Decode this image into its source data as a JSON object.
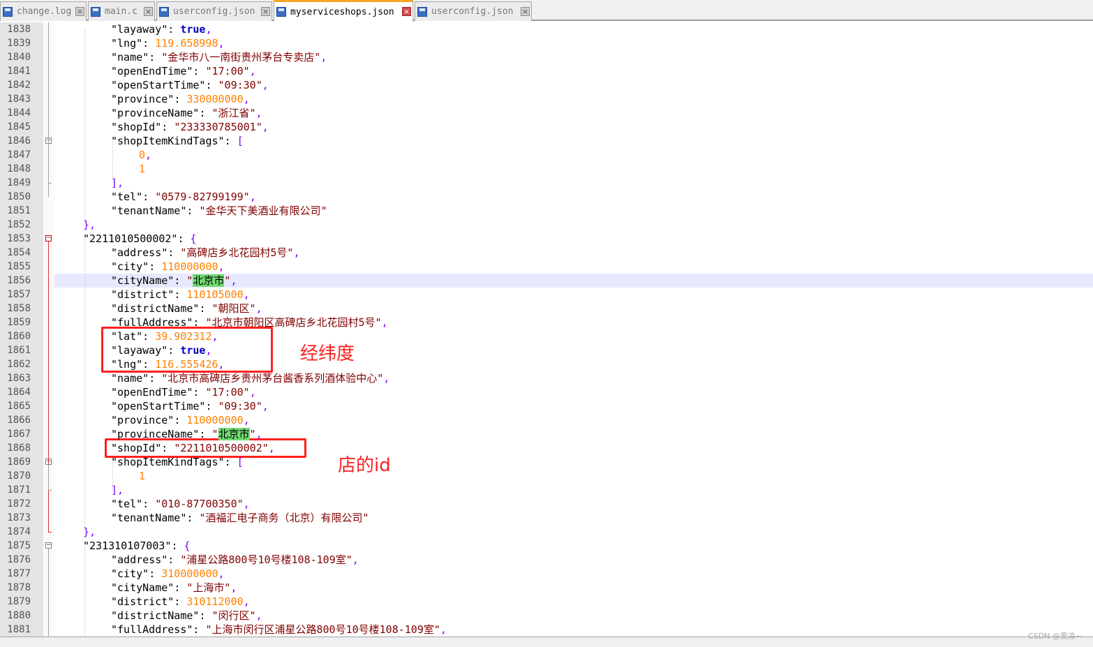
{
  "tabs": [
    {
      "label": "change.log",
      "active": false
    },
    {
      "label": "main.c",
      "active": false
    },
    {
      "label": "userconfig.json",
      "active": false
    },
    {
      "label": "myserviceshops.json",
      "active": true
    },
    {
      "label": "userconfig.json",
      "active": false
    }
  ],
  "lines": [
    {
      "num": "1838",
      "indent": 2,
      "tokens": [
        [
          "k",
          "\"layaway\""
        ],
        [
          "c",
          ": "
        ],
        [
          "b",
          "true"
        ],
        [
          "p",
          ","
        ]
      ]
    },
    {
      "num": "1839",
      "indent": 2,
      "tokens": [
        [
          "k",
          "\"lng\""
        ],
        [
          "c",
          ": "
        ],
        [
          "n",
          "119.658998"
        ],
        [
          "p",
          ","
        ]
      ]
    },
    {
      "num": "1840",
      "indent": 2,
      "tokens": [
        [
          "k",
          "\"name\""
        ],
        [
          "c",
          ": "
        ],
        [
          "s",
          "\"金华市八一南街贵州茅台专卖店\""
        ],
        [
          "p",
          ","
        ]
      ]
    },
    {
      "num": "1841",
      "indent": 2,
      "tokens": [
        [
          "k",
          "\"openEndTime\""
        ],
        [
          "c",
          ": "
        ],
        [
          "s",
          "\"17:00\""
        ],
        [
          "p",
          ","
        ]
      ]
    },
    {
      "num": "1842",
      "indent": 2,
      "tokens": [
        [
          "k",
          "\"openStartTime\""
        ],
        [
          "c",
          ": "
        ],
        [
          "s",
          "\"09:30\""
        ],
        [
          "p",
          ","
        ]
      ]
    },
    {
      "num": "1843",
      "indent": 2,
      "tokens": [
        [
          "k",
          "\"province\""
        ],
        [
          "c",
          ": "
        ],
        [
          "n",
          "330000000"
        ],
        [
          "p",
          ","
        ]
      ]
    },
    {
      "num": "1844",
      "indent": 2,
      "tokens": [
        [
          "k",
          "\"provinceName\""
        ],
        [
          "c",
          ": "
        ],
        [
          "s",
          "\"浙江省\""
        ],
        [
          "p",
          ","
        ]
      ]
    },
    {
      "num": "1845",
      "indent": 2,
      "tokens": [
        [
          "k",
          "\"shopId\""
        ],
        [
          "c",
          ": "
        ],
        [
          "s",
          "\"233330785001\""
        ],
        [
          "p",
          ","
        ]
      ]
    },
    {
      "num": "1846",
      "indent": 2,
      "tokens": [
        [
          "k",
          "\"shopItemKindTags\""
        ],
        [
          "c",
          ": "
        ],
        [
          "p",
          "["
        ]
      ]
    },
    {
      "num": "1847",
      "indent": 3,
      "tokens": [
        [
          "n",
          "0"
        ],
        [
          "p",
          ","
        ]
      ]
    },
    {
      "num": "1848",
      "indent": 3,
      "tokens": [
        [
          "n",
          "1"
        ]
      ]
    },
    {
      "num": "1849",
      "indent": 2,
      "tokens": [
        [
          "p",
          "],"
        ]
      ]
    },
    {
      "num": "1850",
      "indent": 2,
      "tokens": [
        [
          "k",
          "\"tel\""
        ],
        [
          "c",
          ": "
        ],
        [
          "s",
          "\"0579-82799199\""
        ],
        [
          "p",
          ","
        ]
      ]
    },
    {
      "num": "1851",
      "indent": 2,
      "tokens": [
        [
          "k",
          "\"tenantName\""
        ],
        [
          "c",
          ": "
        ],
        [
          "s",
          "\"金华天下美酒业有限公司\""
        ]
      ]
    },
    {
      "num": "1852",
      "indent": 1,
      "tokens": [
        [
          "p",
          "},"
        ]
      ]
    },
    {
      "num": "1853",
      "indent": 1,
      "tokens": [
        [
          "k",
          "\"2211010500002\""
        ],
        [
          "c",
          ": "
        ],
        [
          "p",
          "{"
        ]
      ]
    },
    {
      "num": "1854",
      "indent": 2,
      "tokens": [
        [
          "k",
          "\"address\""
        ],
        [
          "c",
          ": "
        ],
        [
          "s",
          "\"高碑店乡北花园村5号\""
        ],
        [
          "p",
          ","
        ]
      ]
    },
    {
      "num": "1855",
      "indent": 2,
      "tokens": [
        [
          "k",
          "\"city\""
        ],
        [
          "c",
          ": "
        ],
        [
          "n",
          "110000000"
        ],
        [
          "p",
          ","
        ]
      ]
    },
    {
      "num": "1856",
      "indent": 2,
      "tokens": [
        [
          "k",
          "\"cityName\""
        ],
        [
          "c",
          ": "
        ],
        [
          "s",
          "\""
        ],
        [
          "hl",
          "北京市"
        ],
        [
          "s",
          "\""
        ],
        [
          "p",
          ","
        ]
      ]
    },
    {
      "num": "1857",
      "indent": 2,
      "tokens": [
        [
          "k",
          "\"district\""
        ],
        [
          "c",
          ": "
        ],
        [
          "n",
          "110105000"
        ],
        [
          "p",
          ","
        ]
      ]
    },
    {
      "num": "1858",
      "indent": 2,
      "tokens": [
        [
          "k",
          "\"districtName\""
        ],
        [
          "c",
          ": "
        ],
        [
          "s",
          "\"朝阳区\""
        ],
        [
          "p",
          ","
        ]
      ]
    },
    {
      "num": "1859",
      "indent": 2,
      "tokens": [
        [
          "k",
          "\"fullAddress\""
        ],
        [
          "c",
          ": "
        ],
        [
          "s",
          "\"北京市朝阳区高碑店乡北花园村5号\""
        ],
        [
          "p",
          ","
        ]
      ]
    },
    {
      "num": "1860",
      "indent": 2,
      "tokens": [
        [
          "k",
          "\"lat\""
        ],
        [
          "c",
          ": "
        ],
        [
          "n",
          "39.902312"
        ],
        [
          "p",
          ","
        ]
      ]
    },
    {
      "num": "1861",
      "indent": 2,
      "tokens": [
        [
          "k",
          "\"layaway\""
        ],
        [
          "c",
          ": "
        ],
        [
          "b",
          "true"
        ],
        [
          "p",
          ","
        ]
      ]
    },
    {
      "num": "1862",
      "indent": 2,
      "tokens": [
        [
          "k",
          "\"lng\""
        ],
        [
          "c",
          ": "
        ],
        [
          "n",
          "116.555426"
        ],
        [
          "p",
          ","
        ]
      ]
    },
    {
      "num": "1863",
      "indent": 2,
      "tokens": [
        [
          "k",
          "\"name\""
        ],
        [
          "c",
          ": "
        ],
        [
          "s",
          "\"北京市高碑店乡贵州茅台酱香系列酒体验中心\""
        ],
        [
          "p",
          ","
        ]
      ]
    },
    {
      "num": "1864",
      "indent": 2,
      "tokens": [
        [
          "k",
          "\"openEndTime\""
        ],
        [
          "c",
          ": "
        ],
        [
          "s",
          "\"17:00\""
        ],
        [
          "p",
          ","
        ]
      ]
    },
    {
      "num": "1865",
      "indent": 2,
      "tokens": [
        [
          "k",
          "\"openStartTime\""
        ],
        [
          "c",
          ": "
        ],
        [
          "s",
          "\"09:30\""
        ],
        [
          "p",
          ","
        ]
      ]
    },
    {
      "num": "1866",
      "indent": 2,
      "tokens": [
        [
          "k",
          "\"province\""
        ],
        [
          "c",
          ": "
        ],
        [
          "n",
          "110000000"
        ],
        [
          "p",
          ","
        ]
      ]
    },
    {
      "num": "1867",
      "indent": 2,
      "tokens": [
        [
          "k",
          "\"provinceName\""
        ],
        [
          "c",
          ": "
        ],
        [
          "s",
          "\""
        ],
        [
          "hl",
          "北京市"
        ],
        [
          "s",
          "\""
        ],
        [
          "p",
          ","
        ]
      ]
    },
    {
      "num": "1868",
      "indent": 2,
      "tokens": [
        [
          "k",
          "\"shopId\""
        ],
        [
          "c",
          ": "
        ],
        [
          "s",
          "\"2211010500002\""
        ],
        [
          "p",
          ","
        ]
      ]
    },
    {
      "num": "1869",
      "indent": 2,
      "tokens": [
        [
          "k",
          "\"shopItemKindTags\""
        ],
        [
          "c",
          ": "
        ],
        [
          "p",
          "["
        ]
      ]
    },
    {
      "num": "1870",
      "indent": 3,
      "tokens": [
        [
          "n",
          "1"
        ]
      ]
    },
    {
      "num": "1871",
      "indent": 2,
      "tokens": [
        [
          "p",
          "],"
        ]
      ]
    },
    {
      "num": "1872",
      "indent": 2,
      "tokens": [
        [
          "k",
          "\"tel\""
        ],
        [
          "c",
          ": "
        ],
        [
          "s",
          "\"010-87700350\""
        ],
        [
          "p",
          ","
        ]
      ]
    },
    {
      "num": "1873",
      "indent": 2,
      "tokens": [
        [
          "k",
          "\"tenantName\""
        ],
        [
          "c",
          ": "
        ],
        [
          "s",
          "\"酒福汇电子商务（北京）有限公司\""
        ]
      ]
    },
    {
      "num": "1874",
      "indent": 1,
      "tokens": [
        [
          "p",
          "},"
        ]
      ]
    },
    {
      "num": "1875",
      "indent": 1,
      "tokens": [
        [
          "k",
          "\"231310107003\""
        ],
        [
          "c",
          ": "
        ],
        [
          "p",
          "{"
        ]
      ]
    },
    {
      "num": "1876",
      "indent": 2,
      "tokens": [
        [
          "k",
          "\"address\""
        ],
        [
          "c",
          ": "
        ],
        [
          "s",
          "\"浦星公路800号10号楼108-109室\""
        ],
        [
          "p",
          ","
        ]
      ]
    },
    {
      "num": "1877",
      "indent": 2,
      "tokens": [
        [
          "k",
          "\"city\""
        ],
        [
          "c",
          ": "
        ],
        [
          "n",
          "310000000"
        ],
        [
          "p",
          ","
        ]
      ]
    },
    {
      "num": "1878",
      "indent": 2,
      "tokens": [
        [
          "k",
          "\"cityName\""
        ],
        [
          "c",
          ": "
        ],
        [
          "s",
          "\"上海市\""
        ],
        [
          "p",
          ","
        ]
      ]
    },
    {
      "num": "1879",
      "indent": 2,
      "tokens": [
        [
          "k",
          "\"district\""
        ],
        [
          "c",
          ": "
        ],
        [
          "n",
          "310112000"
        ],
        [
          "p",
          ","
        ]
      ]
    },
    {
      "num": "1880",
      "indent": 2,
      "tokens": [
        [
          "k",
          "\"districtName\""
        ],
        [
          "c",
          ": "
        ],
        [
          "s",
          "\"闵行区\""
        ],
        [
          "p",
          ","
        ]
      ]
    },
    {
      "num": "1881",
      "indent": 2,
      "tokens": [
        [
          "k",
          "\"fullAddress\""
        ],
        [
          "c",
          ": "
        ],
        [
          "s",
          "\"上海市闵行区浦星公路800号10号楼108-109室\""
        ],
        [
          "p",
          ","
        ]
      ]
    }
  ],
  "annotations": {
    "latlng_label": "经纬度",
    "shopid_label": "店的id"
  },
  "colors": {
    "annotation": "#ff2020",
    "highlight": "#6fdb6f",
    "current_line": "#e8e8ff"
  },
  "watermark": "CSDN @乘凉~"
}
